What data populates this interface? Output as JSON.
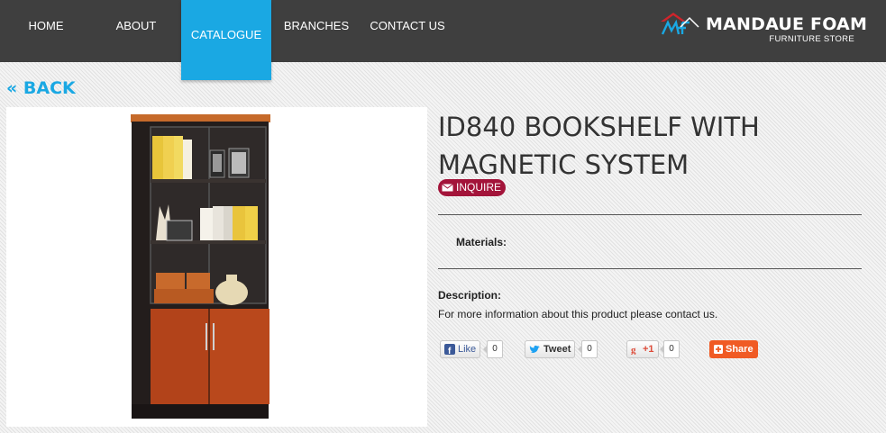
{
  "nav": {
    "items": [
      {
        "label": "HOME",
        "active": false
      },
      {
        "label": "ABOUT",
        "active": false
      },
      {
        "label": "CATALOGUE",
        "active": true
      },
      {
        "label": "BRANCHES",
        "active": false
      },
      {
        "label": "CONTACT US",
        "active": false
      }
    ],
    "active_color": "#1aa8e3",
    "bar_color": "#3f3f3f"
  },
  "brand": {
    "name": "MANDAUE FOAM",
    "tagline": "FURNITURE STORE",
    "logo_icon": "mf-logo-icon"
  },
  "back_label": "« BACK",
  "product": {
    "title": "ID840 BOOKSHELF WITH MAGNETIC SYSTEM",
    "inquire_label": "INQUIRE",
    "inquire_icon": "envelope-icon",
    "materials_label": "Materials:",
    "description_label": "Description:",
    "description_text": "For more information about this product please contact us.",
    "image_alt": "bookshelf-image"
  },
  "social": {
    "facebook": {
      "label": "Like",
      "count": "0",
      "icon": "facebook-icon"
    },
    "twitter": {
      "label": "Tweet",
      "count": "0",
      "icon": "twitter-bird-icon"
    },
    "google": {
      "label": "+1",
      "count": "0",
      "icon": "google-plus-icon"
    },
    "sharethis": {
      "label": "Share",
      "icon": "plus-square-icon"
    }
  },
  "colors": {
    "accent": "#1aa8e3",
    "inquire": "#a3143a",
    "share": "#f05a24"
  }
}
